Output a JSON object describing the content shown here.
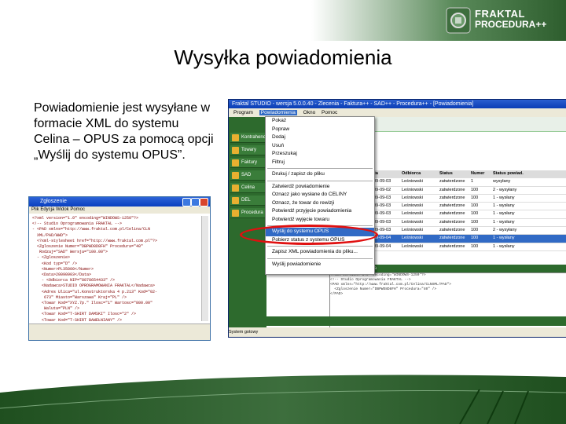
{
  "brand": {
    "line1": "FRAKTAL",
    "line2": "PROCEDURA++"
  },
  "title": "Wysyłka powiadomienia",
  "body_text": "Powiadomienie jest wysyłane w formacie XML do systemu Celina – OPUS za pomocą opcji „Wyślij do systemu OPUS”.",
  "xml_window": {
    "title": "Zgłoszenie",
    "menu": "Plik  Edycja  Widok  Pomoc",
    "lines": [
      "<?xml version=\"1.0\" encoding=\"WINDOWS-1250\"?>",
      "<!-- Studio Oprogramowania FRAKTAL -->",
      "- <PAD xmlns=\"http://www.fraktal.com.pl/Celina/CLN",
      "  XML/PAD/WWD\">",
      "  <?xml-stylesheet href=\"http://www.fraktal.com.pl\"?>",
      "  <Zgloszenie Numer=\"DBPWD8D8FH\" Procedura=\"40\"",
      "   Rodzaj=\"SAD\" Wersja=\"100.00\">",
      "  - <Zgloszenie>",
      "    <Kod typ=\"D\" />",
      "    <Numer>PL35000</Numer>",
      "    <Data>20090903</Data>",
      "    - <Odbiorca NIP=\"8878654433\" />",
      "    <Nadawca>STUDIO OPROGRAMOWANIA FRAKTAL</Nadawca>",
      "    <Adres Ulica=\"ul.Konstruktorska 4 p.213\" Kod=\"02-",
      "     673\" Miasto=\"Warszawa\" Kraj=\"PL\" />",
      "    <Towar Kod=\"XYZ.7p.\" Ilosc=\"1\" Wartosc=\"800.00\"",
      "     Waluta=\"PLN\" />",
      "    <Towar Kod=\"T-SHIRT DAMSKI\" Ilosc=\"2\" />",
      "    <Towar Kod=\"T-SHIRT BAWEŁNIANY\" />",
      "  </Zgloszenie>",
      "</PAD>"
    ]
  },
  "app": {
    "title": "Fraktal STUDIO - wersja 5.0.0.40 - Zlecenia - Faktura++ - SAD++ - Procedura++ - [Powiadomienia]",
    "menu": [
      "Program",
      "Powiadomienia",
      "Okno",
      "Pomoc"
    ],
    "sidebar": [
      "Kontrahenci",
      "Towary",
      "Faktury",
      "SAD",
      "Celina",
      "DEL",
      "Procedura"
    ],
    "grid_head": [
      "Data",
      "Odbiorca",
      "Status",
      "Numer",
      "Status powiad."
    ],
    "grid_rows": [
      [
        "2009-09-03",
        "Leśniowski",
        "zatwierdzone",
        "1",
        "wysyłany"
      ],
      [
        "2009-09-02",
        "Leśniowski",
        "zatwierdzone",
        "100",
        "2 - wysyłany"
      ],
      [
        "2009-09-03",
        "Leśniowski",
        "zatwierdzone",
        "100",
        "1 - wysłany"
      ],
      [
        "2009-09-03",
        "Leśniowski",
        "zatwierdzone",
        "100",
        "1 - wysłany"
      ],
      [
        "2009-09-03",
        "Leśniowski",
        "zatwierdzone",
        "100",
        "1 - wysłany"
      ],
      [
        "2009-09-03",
        "Leśniowski",
        "zatwierdzone",
        "100",
        "1 - wysłany"
      ],
      [
        "2009-09-03",
        "Leśniowski",
        "zatwierdzone",
        "100",
        "2 - wysyłany"
      ],
      [
        "2009-09-04",
        "Leśniowski",
        "zatwierdzone",
        "100",
        "1 - wysłany"
      ],
      [
        "2009-09-04",
        "Leśniowski",
        "zatwierdzone",
        "100",
        "1 - wysłany"
      ]
    ],
    "lower_title": "Dane powiadomienia",
    "lower_lines": [
      "<?xml version=\"1.0\" encoding=\"WINDOWS-1250\"?>",
      "<!-- Studio Oprogramowania FRAKTAL -->",
      "<PAD xmlns=\"http://www.fraktal.com.pl/Celina/CLNXML/PAD\">",
      "  <Zgloszenie Numer=\"DBPWD8D8FH\" Procedura=\"40\" />",
      "</PAD>"
    ],
    "status": "System gotowy"
  },
  "dropdown": {
    "items": [
      "Pokaż",
      "Popraw",
      "Dodaj",
      "Usuń",
      "Przeszukaj",
      "Filtruj",
      "---",
      "Drukuj / zapisz do pliku",
      "---",
      "Zatwierdź powiadomienie",
      "Oznacz jako wysłane do CELINY",
      "Oznacz, że towar do rewizji",
      "Potwierdź przyjęcie powiadomienia",
      "Potwierdź wyjęcie towaru",
      "---",
      "Wyślij do systemu OPUS",
      "Pobierz status z systemu OPUS",
      "---",
      "Zapisz XML powiadomienia do pliku...",
      "---",
      "Wyślij powiadomienie"
    ],
    "highlighted": "Wyślij do systemu OPUS"
  }
}
